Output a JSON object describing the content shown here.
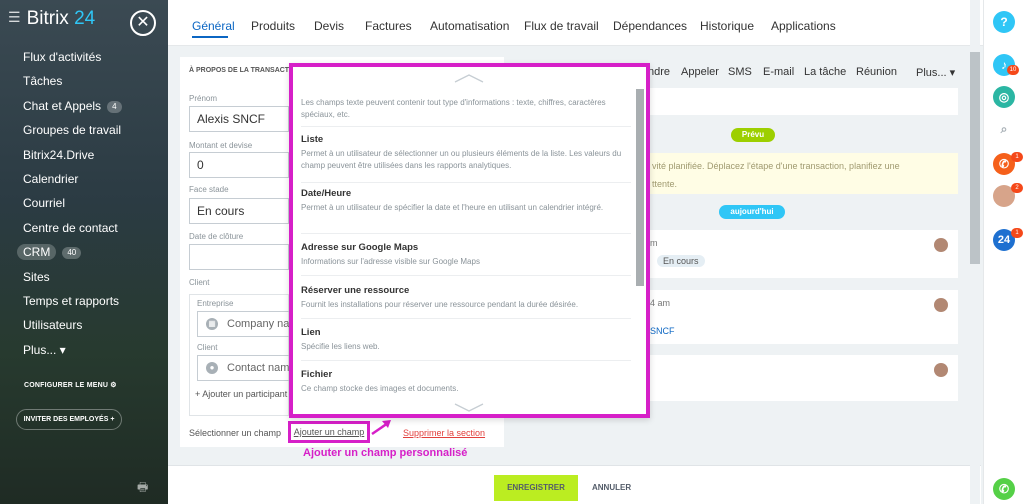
{
  "sidebar": {
    "logo_text": "Bitrix",
    "logo_num": "24",
    "items": [
      {
        "label": "Flux d'activités"
      },
      {
        "label": "Tâches"
      },
      {
        "label": "Chat et Appels",
        "badge": "4"
      },
      {
        "label": "Groupes de travail"
      },
      {
        "label": "Bitrix24.Drive"
      },
      {
        "label": "Calendrier"
      },
      {
        "label": "Courriel"
      },
      {
        "label": "Centre de contact"
      },
      {
        "label": "CRM",
        "badge": "40"
      },
      {
        "label": "Sites"
      },
      {
        "label": "Temps et rapports"
      },
      {
        "label": "Utilisateurs"
      },
      {
        "label": "Plus... ▾"
      }
    ],
    "configure_menu": "CONFIGURER LE MENU",
    "invite_label": "INVITER DES EMPLOYÉS +"
  },
  "tabs": [
    "Général",
    "Produits",
    "Devis",
    "Factures",
    "Automatisation",
    "Flux de travail",
    "Dépendances",
    "Historique",
    "Applications"
  ],
  "form": {
    "section_title": "À PROPOS DE LA TRANSACTION",
    "prenom_label": "Prénom",
    "prenom_value": "Alexis SNCF",
    "montant_label": "Montant et devise",
    "montant_value": "0",
    "stade_label": "Face stade",
    "stade_value": "En cours",
    "cloture_label": "Date de clôture",
    "cloture_value": "",
    "client_label": "Client",
    "entreprise_label": "Entreprise",
    "entreprise_placeholder": "Company name",
    "contact_sub_label": "Client",
    "contact_placeholder": "Contact name",
    "add_participant": "+ Ajouter un participant",
    "select_field": "Sélectionner un champ",
    "add_field": "Ajouter un champ",
    "delete_section": "Supprimer la section"
  },
  "annotation": "Ajouter un champ personnalisé",
  "popup": {
    "intro": "Les champs texte peuvent contenir tout type d'informations : texte, chiffres, caractères spéciaux, etc.",
    "items": [
      {
        "title": "Liste",
        "desc": "Permet à un utilisateur de sélectionner un ou plusieurs éléments de la liste. Les valeurs du champ peuvent être utilisées dans les rapports analytiques."
      },
      {
        "title": "Date/Heure",
        "desc": "Permet à un utilisateur de spécifier la date et l'heure en utilisant un calendrier intégré."
      },
      {
        "title": "Adresse sur Google Maps",
        "desc": "Informations sur l'adresse visible sur Google Maps"
      },
      {
        "title": "Réserver une ressource",
        "desc": "Fournit les installations pour réserver une ressource pendant la durée désirée."
      },
      {
        "title": "Lien",
        "desc": "Spécifie les liens web."
      },
      {
        "title": "Fichier",
        "desc": "Ce champ stocke des images et documents."
      }
    ]
  },
  "timeline": {
    "actions": [
      "ndre",
      "Appeler",
      "SMS",
      "E-mail",
      "La tâche",
      "Réunion",
      "Plus... ▾"
    ],
    "prevu": "Prévu",
    "note": "vité planifiée. Déplacez l'étape d'une transaction, planifiez une",
    "note2": "ttente.",
    "aujourdhui": "aujourd'hui",
    "card1_time": "m",
    "card1_badge": "En cours",
    "card2_time": "4 am",
    "card2_text": "SNCF"
  },
  "bottom": {
    "save": "ENREGISTRER",
    "cancel": "ANNULER"
  },
  "rail": {
    "help": "?",
    "notif_badge": "10",
    "badge1": "1",
    "badge2": "2",
    "badge3": "1",
    "b24": "24"
  },
  "colors": {
    "accent": "#0b66c3",
    "highlight": "#d61fc8",
    "save_green": "#bbed21",
    "prevu_green": "#9dcf00",
    "today_blue": "#2fc6f6"
  }
}
